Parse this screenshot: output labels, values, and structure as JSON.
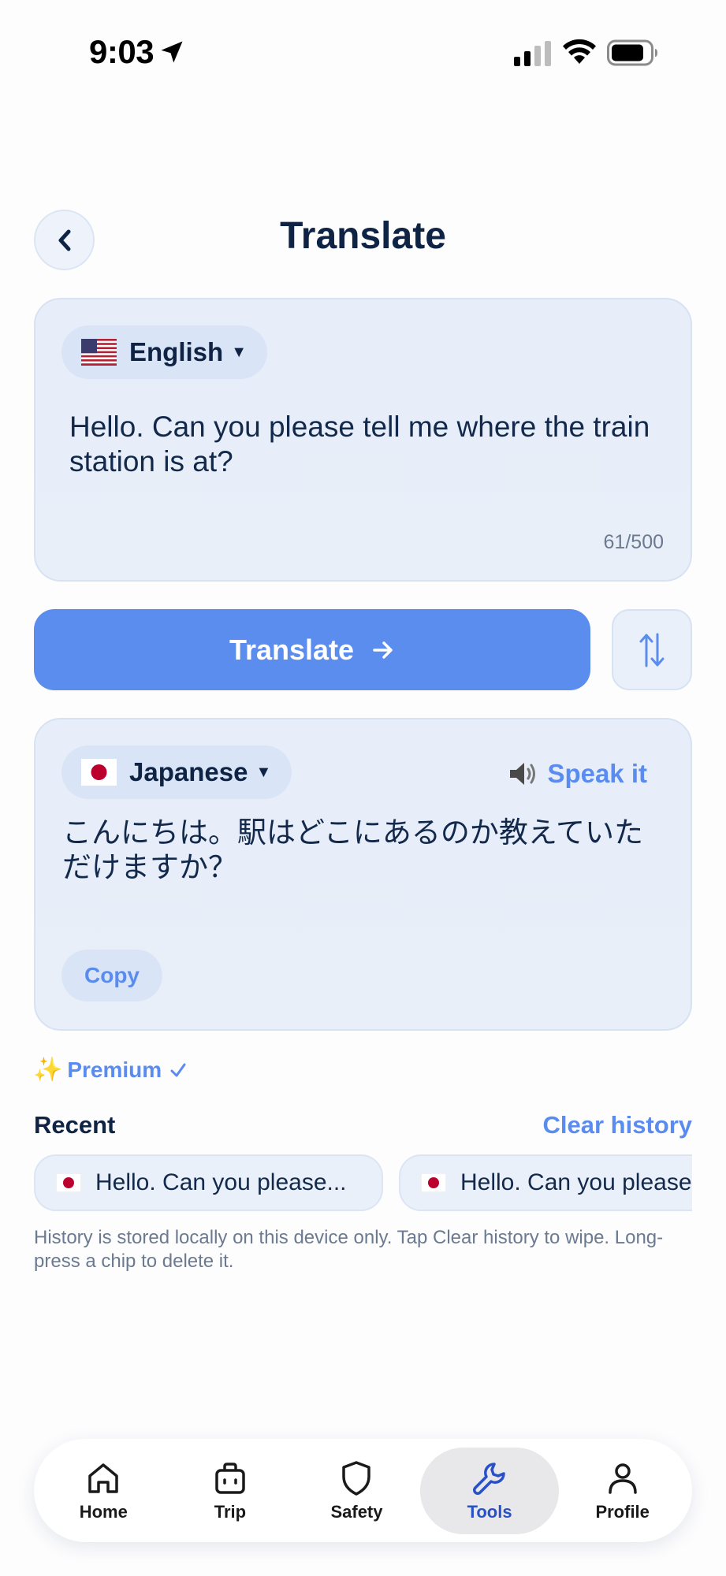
{
  "status_bar": {
    "time": "9:03"
  },
  "header": {
    "title": "Translate"
  },
  "source": {
    "language": "English",
    "text": "Hello.  Can you please tell me where the train station is at?",
    "char_count": "61/500"
  },
  "actions": {
    "translate_label": "Translate"
  },
  "target": {
    "language": "Japanese",
    "speak_label": "Speak it",
    "text": "こんにちは。駅はどこにあるのか教えていただけますか？",
    "copy_label": "Copy"
  },
  "premium": {
    "label": "Premium",
    "sparkle": "✨"
  },
  "recent": {
    "title": "Recent",
    "clear_label": "Clear history",
    "chips": [
      {
        "text": "Hello.  Can you please..."
      },
      {
        "text": "Hello.  Can you please..."
      }
    ],
    "note": "History is stored locally on this device only. Tap Clear history to wipe. Long-press a chip to delete it."
  },
  "tabs": [
    {
      "label": "Home",
      "icon": "home-icon"
    },
    {
      "label": "Trip",
      "icon": "briefcase-icon"
    },
    {
      "label": "Safety",
      "icon": "shield-icon"
    },
    {
      "label": "Tools",
      "icon": "wrench-icon",
      "active": true
    },
    {
      "label": "Profile",
      "icon": "person-icon"
    }
  ],
  "colors": {
    "accent": "#5b8def",
    "title": "#0f2344",
    "card_bg": "#e7eef9",
    "active_tab": "#2850c8"
  }
}
